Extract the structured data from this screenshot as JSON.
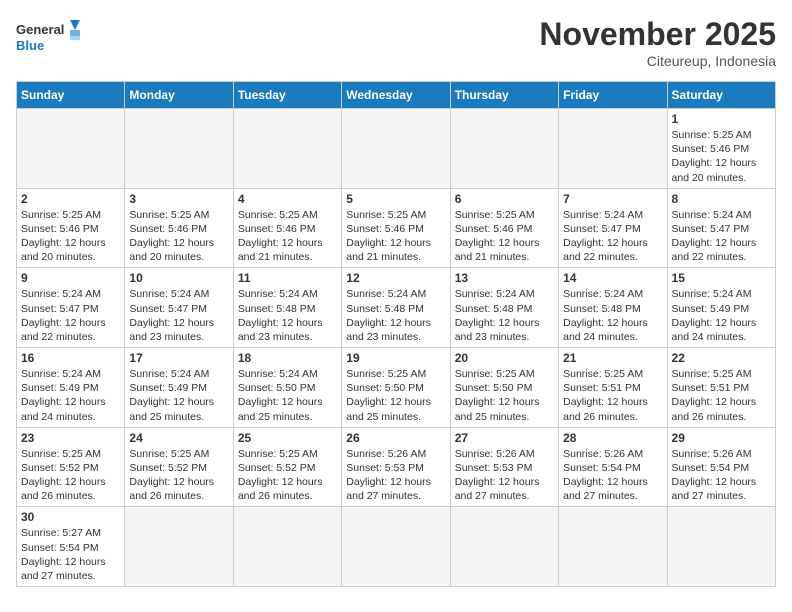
{
  "header": {
    "logo_general": "General",
    "logo_blue": "Blue",
    "month_title": "November 2025",
    "subtitle": "Citeureup, Indonesia"
  },
  "days_of_week": [
    "Sunday",
    "Monday",
    "Tuesday",
    "Wednesday",
    "Thursday",
    "Friday",
    "Saturday"
  ],
  "weeks": [
    [
      {
        "day": "",
        "info": ""
      },
      {
        "day": "",
        "info": ""
      },
      {
        "day": "",
        "info": ""
      },
      {
        "day": "",
        "info": ""
      },
      {
        "day": "",
        "info": ""
      },
      {
        "day": "",
        "info": ""
      },
      {
        "day": "1",
        "info": "Sunrise: 5:25 AM\nSunset: 5:46 PM\nDaylight: 12 hours and 20 minutes."
      }
    ],
    [
      {
        "day": "2",
        "info": "Sunrise: 5:25 AM\nSunset: 5:46 PM\nDaylight: 12 hours and 20 minutes."
      },
      {
        "day": "3",
        "info": "Sunrise: 5:25 AM\nSunset: 5:46 PM\nDaylight: 12 hours and 20 minutes."
      },
      {
        "day": "4",
        "info": "Sunrise: 5:25 AM\nSunset: 5:46 PM\nDaylight: 12 hours and 21 minutes."
      },
      {
        "day": "5",
        "info": "Sunrise: 5:25 AM\nSunset: 5:46 PM\nDaylight: 12 hours and 21 minutes."
      },
      {
        "day": "6",
        "info": "Sunrise: 5:25 AM\nSunset: 5:46 PM\nDaylight: 12 hours and 21 minutes."
      },
      {
        "day": "7",
        "info": "Sunrise: 5:24 AM\nSunset: 5:47 PM\nDaylight: 12 hours and 22 minutes."
      },
      {
        "day": "8",
        "info": "Sunrise: 5:24 AM\nSunset: 5:47 PM\nDaylight: 12 hours and 22 minutes."
      }
    ],
    [
      {
        "day": "9",
        "info": "Sunrise: 5:24 AM\nSunset: 5:47 PM\nDaylight: 12 hours and 22 minutes."
      },
      {
        "day": "10",
        "info": "Sunrise: 5:24 AM\nSunset: 5:47 PM\nDaylight: 12 hours and 23 minutes."
      },
      {
        "day": "11",
        "info": "Sunrise: 5:24 AM\nSunset: 5:48 PM\nDaylight: 12 hours and 23 minutes."
      },
      {
        "day": "12",
        "info": "Sunrise: 5:24 AM\nSunset: 5:48 PM\nDaylight: 12 hours and 23 minutes."
      },
      {
        "day": "13",
        "info": "Sunrise: 5:24 AM\nSunset: 5:48 PM\nDaylight: 12 hours and 23 minutes."
      },
      {
        "day": "14",
        "info": "Sunrise: 5:24 AM\nSunset: 5:48 PM\nDaylight: 12 hours and 24 minutes."
      },
      {
        "day": "15",
        "info": "Sunrise: 5:24 AM\nSunset: 5:49 PM\nDaylight: 12 hours and 24 minutes."
      }
    ],
    [
      {
        "day": "16",
        "info": "Sunrise: 5:24 AM\nSunset: 5:49 PM\nDaylight: 12 hours and 24 minutes."
      },
      {
        "day": "17",
        "info": "Sunrise: 5:24 AM\nSunset: 5:49 PM\nDaylight: 12 hours and 25 minutes."
      },
      {
        "day": "18",
        "info": "Sunrise: 5:24 AM\nSunset: 5:50 PM\nDaylight: 12 hours and 25 minutes."
      },
      {
        "day": "19",
        "info": "Sunrise: 5:25 AM\nSunset: 5:50 PM\nDaylight: 12 hours and 25 minutes."
      },
      {
        "day": "20",
        "info": "Sunrise: 5:25 AM\nSunset: 5:50 PM\nDaylight: 12 hours and 25 minutes."
      },
      {
        "day": "21",
        "info": "Sunrise: 5:25 AM\nSunset: 5:51 PM\nDaylight: 12 hours and 26 minutes."
      },
      {
        "day": "22",
        "info": "Sunrise: 5:25 AM\nSunset: 5:51 PM\nDaylight: 12 hours and 26 minutes."
      }
    ],
    [
      {
        "day": "23",
        "info": "Sunrise: 5:25 AM\nSunset: 5:52 PM\nDaylight: 12 hours and 26 minutes."
      },
      {
        "day": "24",
        "info": "Sunrise: 5:25 AM\nSunset: 5:52 PM\nDaylight: 12 hours and 26 minutes."
      },
      {
        "day": "25",
        "info": "Sunrise: 5:25 AM\nSunset: 5:52 PM\nDaylight: 12 hours and 26 minutes."
      },
      {
        "day": "26",
        "info": "Sunrise: 5:26 AM\nSunset: 5:53 PM\nDaylight: 12 hours and 27 minutes."
      },
      {
        "day": "27",
        "info": "Sunrise: 5:26 AM\nSunset: 5:53 PM\nDaylight: 12 hours and 27 minutes."
      },
      {
        "day": "28",
        "info": "Sunrise: 5:26 AM\nSunset: 5:54 PM\nDaylight: 12 hours and 27 minutes."
      },
      {
        "day": "29",
        "info": "Sunrise: 5:26 AM\nSunset: 5:54 PM\nDaylight: 12 hours and 27 minutes."
      }
    ],
    [
      {
        "day": "30",
        "info": "Sunrise: 5:27 AM\nSunset: 5:54 PM\nDaylight: 12 hours and 27 minutes."
      },
      {
        "day": "",
        "info": ""
      },
      {
        "day": "",
        "info": ""
      },
      {
        "day": "",
        "info": ""
      },
      {
        "day": "",
        "info": ""
      },
      {
        "day": "",
        "info": ""
      },
      {
        "day": "",
        "info": ""
      }
    ]
  ]
}
